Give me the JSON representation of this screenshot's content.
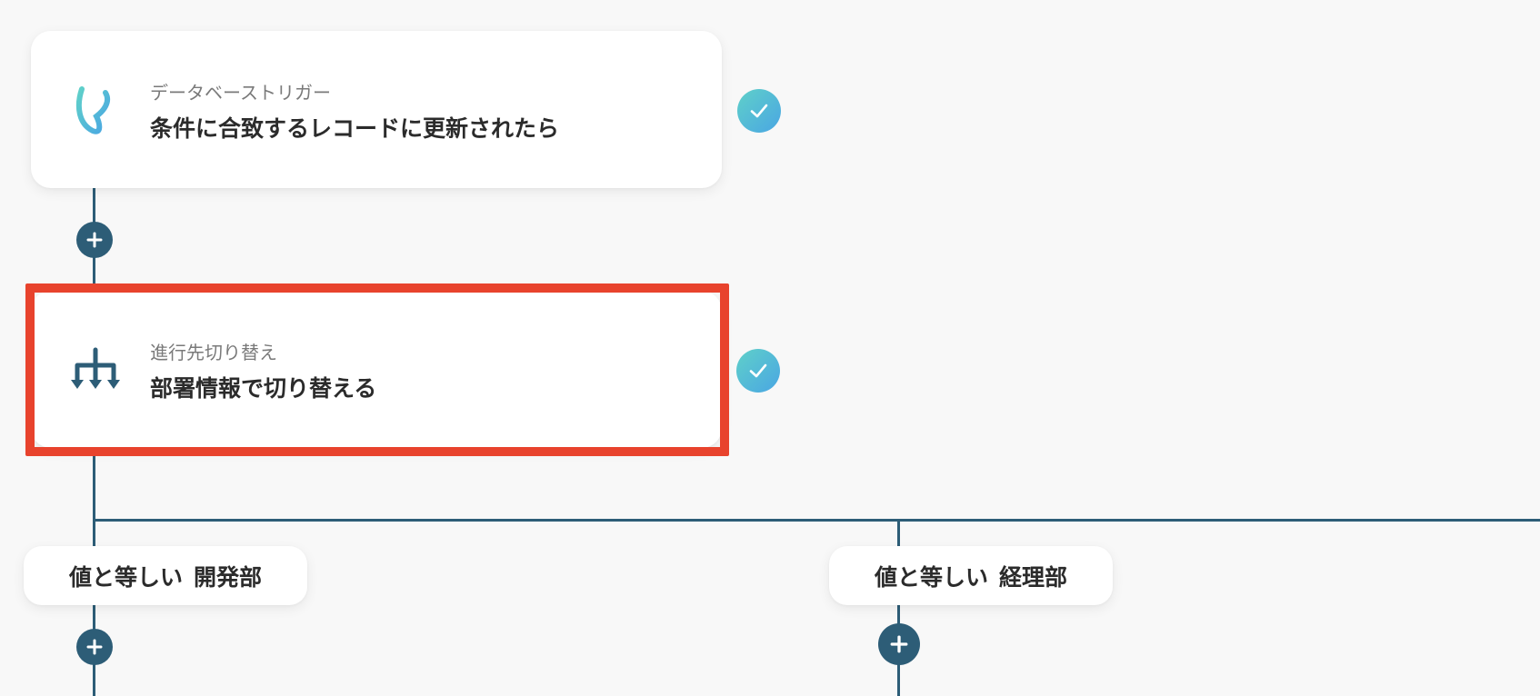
{
  "flow": {
    "trigger": {
      "subtitle": "データベーストリガー",
      "title": "条件に合致するレコードに更新されたら",
      "icon": "yoom-logo-icon",
      "status": "completed"
    },
    "branch_step": {
      "subtitle": "進行先切り替え",
      "title": "部署情報で切り替える",
      "icon": "branch-switch-icon",
      "status": "completed",
      "highlighted": true
    },
    "branches": [
      {
        "condition": "値と等しい",
        "value": "開発部"
      },
      {
        "condition": "値と等しい",
        "value": "経理部"
      }
    ]
  },
  "colors": {
    "line": "#2d5d77",
    "highlight": "#e8432d",
    "check_gradient_start": "#5fd0c9",
    "check_gradient_end": "#4aa6e3",
    "background": "#f8f8f8"
  }
}
